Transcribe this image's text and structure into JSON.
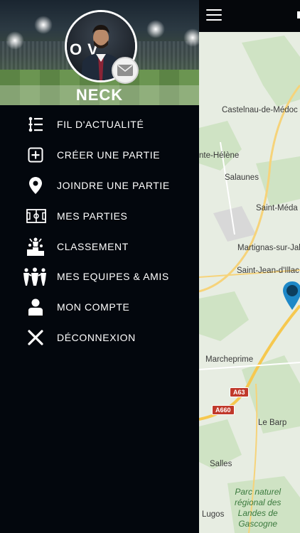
{
  "drawer": {
    "user_name": "NECK",
    "avatar_text": "OV",
    "menu": [
      {
        "label": "FIL D'ACTUALITÉ",
        "icon": "news-feed-icon"
      },
      {
        "label": "CRÉER UNE PARTIE",
        "icon": "add-square-icon"
      },
      {
        "label": "JOINDRE UNE PARTIE",
        "icon": "location-pin-icon"
      },
      {
        "label": "MES PARTIES",
        "icon": "pitch-icon"
      },
      {
        "label": "CLASSEMENT",
        "icon": "trophy-podium-icon"
      },
      {
        "label": "MES EQUIPES & AMIS",
        "icon": "team-icon"
      },
      {
        "label": "MON COMPTE",
        "icon": "user-icon"
      },
      {
        "label": "DÉCONNEXION",
        "icon": "close-icon"
      }
    ]
  },
  "map": {
    "labels": [
      "Castelnau-de-Médoc",
      "nte-Hélène",
      "Salaunes",
      "Saint-Méda",
      "Martignas-sur-Jall",
      "Saint-Jean-d'Illac",
      "Marcheprime",
      "Le Barp",
      "Salles",
      "Lugos"
    ],
    "park_label": [
      "Parc naturel",
      "régional des",
      "Landes de",
      "Gascogne"
    ],
    "roads": [
      "A63",
      "A660"
    ]
  },
  "colors": {
    "drawer_bg": "#03070d",
    "map_bg": "#e7ede2",
    "pin": "#1e88c7"
  }
}
